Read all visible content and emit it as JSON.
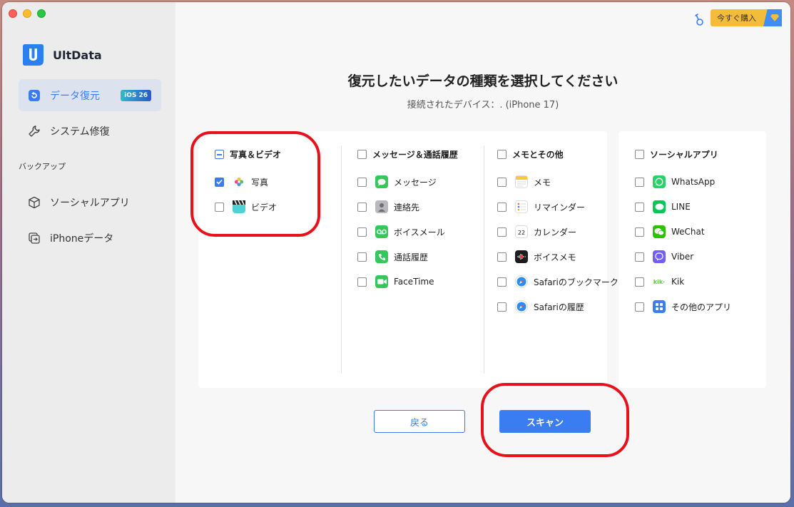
{
  "sidebar": {
    "app_name": "UltData",
    "nav": [
      {
        "label": "データ復元",
        "badge": "iOS 26",
        "active": true
      },
      {
        "label": "システム修復"
      }
    ],
    "backup_section_label": "バックアップ",
    "backup_items": [
      {
        "label": "ソーシャルアプリ"
      },
      {
        "label": "iPhoneデータ"
      }
    ]
  },
  "topbar": {
    "buy_label": "今すぐ購入",
    "accent_color": "#3a7df2"
  },
  "main": {
    "title": "復元したいデータの種類を選択してください",
    "subtitle": "接続されたデバイス：. (iPhone 17)",
    "categories": [
      {
        "label": "写真＆ビデオ",
        "state": "partial",
        "items": [
          {
            "label": "写真",
            "icon": "photos-icon",
            "checked": true
          },
          {
            "label": "ビデオ",
            "icon": "clapperboard-icon",
            "checked": false
          }
        ]
      },
      {
        "label": "メッセージ＆通話履歴",
        "state": "unchecked",
        "items": [
          {
            "label": "メッセージ",
            "icon": "messages-icon",
            "checked": false
          },
          {
            "label": "連絡先",
            "icon": "contacts-icon",
            "checked": false
          },
          {
            "label": "ボイスメール",
            "icon": "voicemail-icon",
            "checked": false
          },
          {
            "label": "通話履歴",
            "icon": "phone-icon",
            "checked": false
          },
          {
            "label": "FaceTime",
            "icon": "facetime-icon",
            "checked": false
          }
        ]
      },
      {
        "label": "メモとその他",
        "state": "unchecked",
        "items": [
          {
            "label": "メモ",
            "icon": "notes-icon",
            "checked": false
          },
          {
            "label": "リマインダー",
            "icon": "reminders-icon",
            "checked": false
          },
          {
            "label": "カレンダー",
            "icon": "calendar-icon",
            "checked": false,
            "icon_text": "22"
          },
          {
            "label": "ボイスメモ",
            "icon": "voice-memos-icon",
            "checked": false
          },
          {
            "label": "Safariのブックマーク",
            "icon": "safari-icon",
            "checked": false
          },
          {
            "label": "Safariの履歴",
            "icon": "safari-icon",
            "checked": false
          }
        ]
      },
      {
        "label": "ソーシャルアプリ",
        "state": "unchecked",
        "items": [
          {
            "label": "WhatsApp",
            "icon": "whatsapp-icon",
            "checked": false
          },
          {
            "label": "LINE",
            "icon": "line-icon",
            "checked": false
          },
          {
            "label": "WeChat",
            "icon": "wechat-icon",
            "checked": false
          },
          {
            "label": "Viber",
            "icon": "viber-icon",
            "checked": false
          },
          {
            "label": "Kik",
            "icon": "kik-icon",
            "checked": false,
            "icon_text": "kik·"
          },
          {
            "label": "その他のアプリ",
            "icon": "other-apps-icon",
            "checked": false
          }
        ]
      }
    ],
    "back_label": "戻る",
    "scan_label": "スキャン"
  }
}
